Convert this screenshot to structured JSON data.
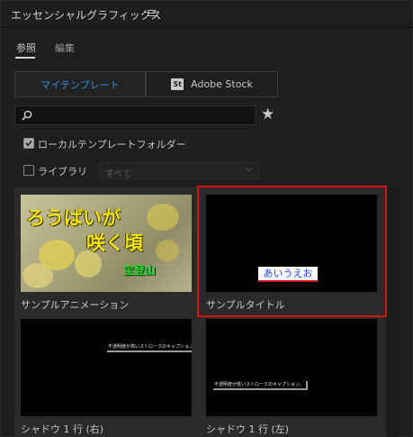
{
  "panel": {
    "title": "エッセンシャルグラフィックス",
    "menu_icon": "hamburger-menu-icon"
  },
  "tabs": [
    {
      "label": "参照",
      "active": true
    },
    {
      "label": "編集",
      "active": false
    }
  ],
  "source_toggle": {
    "my_templates": "マイテンプレート",
    "adobe_stock_badge": "St",
    "adobe_stock": "Adobe Stock",
    "active": "my_templates"
  },
  "search": {
    "value": "",
    "icon": "search-icon",
    "star_icon": "star-icon"
  },
  "filters": {
    "local_folder": {
      "label": "ローカルテンプレートフォルダー",
      "checked": true
    },
    "library": {
      "label": "ライブラリ",
      "checked": false,
      "dropdown_value": "すべて"
    }
  },
  "templates": [
    {
      "label": "サンプルアニメーション",
      "thumb": {
        "line1": "ろうばいが",
        "line2": "咲く頃",
        "line3": "宝登山"
      }
    },
    {
      "label": "サンプルタイトル",
      "selected": true,
      "thumb": {
        "text": "あいうえお"
      }
    },
    {
      "label": "シャドウ 1 行 (右)",
      "thumb": {
        "text": "不透明度が高いストロークのキャプション。"
      }
    },
    {
      "label": "シャドウ 1 行 (左)",
      "thumb": {
        "text": "不透明度が低いストロークのキャプション。"
      }
    }
  ],
  "colors": {
    "accent": "#2d8ceb",
    "selection": "#d41414",
    "panel_bg": "#1e1e1e",
    "grid_bg": "#2a2a2a"
  }
}
